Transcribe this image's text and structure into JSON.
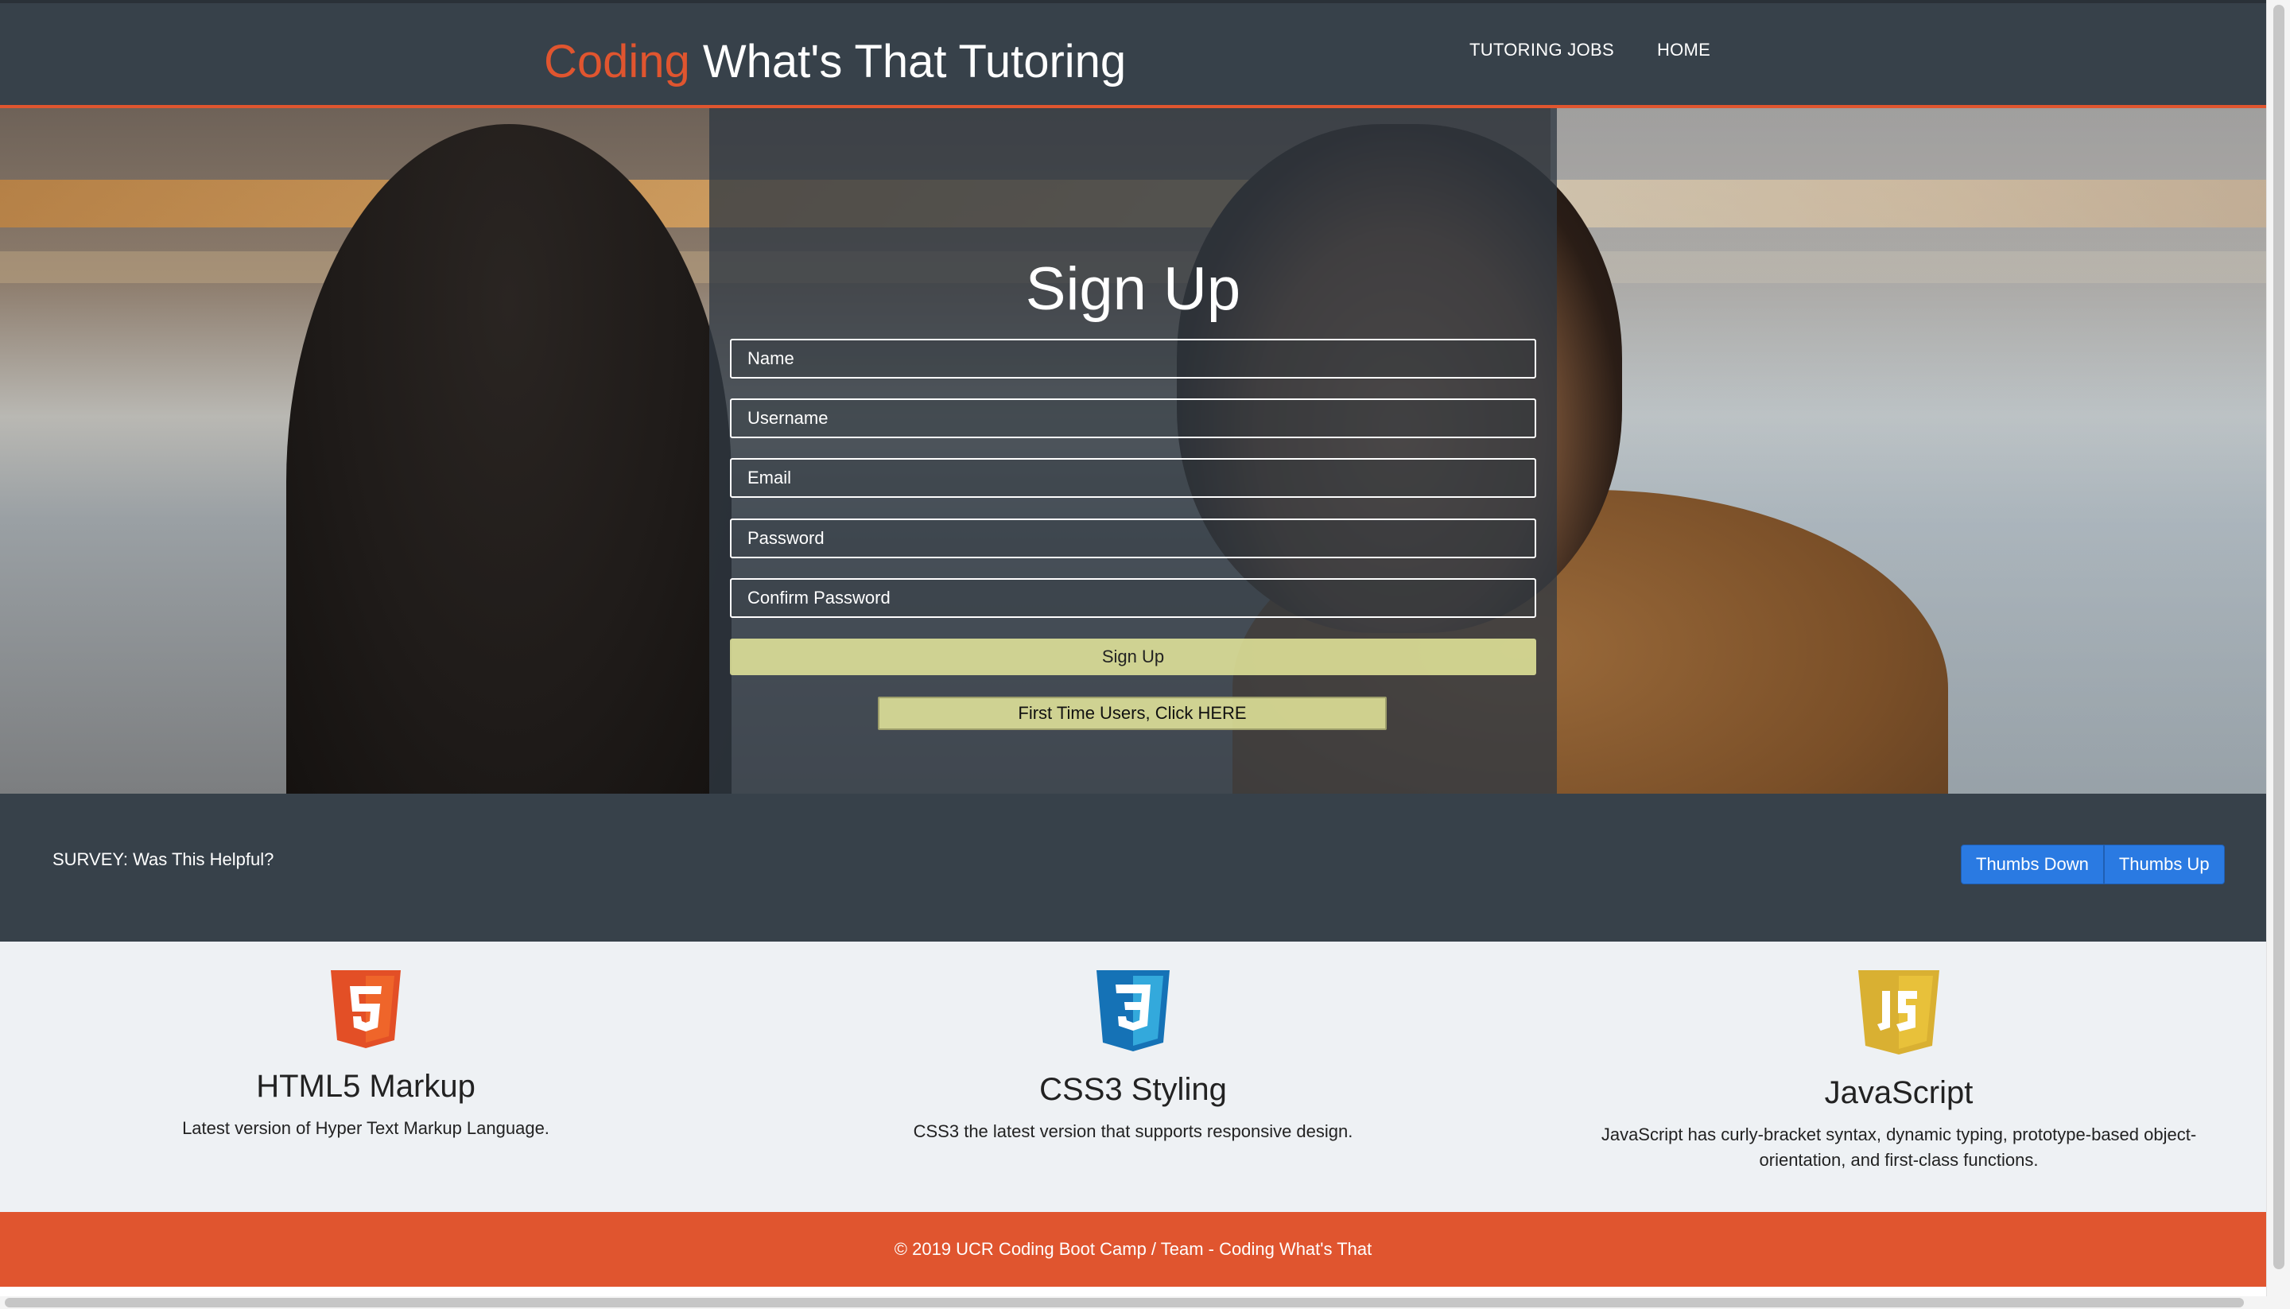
{
  "header": {
    "brand_accent": "Coding",
    "brand_rest": " What's That Tutoring",
    "nav": [
      {
        "label": "TUTORING JOBS"
      },
      {
        "label": "HOME"
      }
    ]
  },
  "signup": {
    "title": "Sign Up",
    "fields": {
      "name": {
        "placeholder": "Name",
        "value": ""
      },
      "username": {
        "placeholder": "Username",
        "value": ""
      },
      "email": {
        "placeholder": "Email",
        "value": ""
      },
      "password": {
        "placeholder": "Password",
        "value": ""
      },
      "confirm": {
        "placeholder": "Confirm Password",
        "value": ""
      }
    },
    "submit_label": "Sign Up",
    "first_time_label": "First Time Users, Click HERE"
  },
  "survey": {
    "question": "SURVEY: Was This Helpful?",
    "thumbs_down": "Thumbs Down",
    "thumbs_up": "Thumbs Up"
  },
  "features": [
    {
      "icon": "html5-icon",
      "title": "HTML5 Markup",
      "text": "Latest version of Hyper Text Markup Language.",
      "color": "#e34f26"
    },
    {
      "icon": "css3-icon",
      "title": "CSS3 Styling",
      "text": "CSS3 the latest version that supports responsive design.",
      "color": "#1572b6"
    },
    {
      "icon": "javascript-icon",
      "title": "JavaScript",
      "text": "JavaScript has curly-bracket syntax, dynamic typing, prototype-based object-orientation, and first-class functions.",
      "color": "#e8c13a"
    }
  ],
  "footer": {
    "text": "© 2019 UCR Coding Boot Camp / Team - Coding What's That"
  },
  "colors": {
    "accent": "#e0552f",
    "dark": "#37414a",
    "button_blue": "#2a7ae2",
    "signup_button": "#eef0a0"
  }
}
